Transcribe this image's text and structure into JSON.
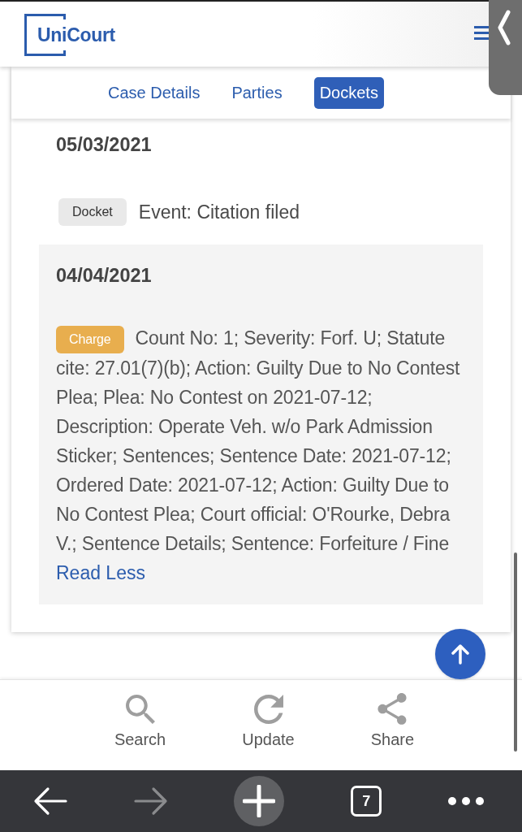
{
  "header": {
    "logo": "UniCourt"
  },
  "tabs": [
    {
      "label": "Case Details",
      "selected": false
    },
    {
      "label": "Parties",
      "selected": false
    },
    {
      "label": "Dockets",
      "selected": true
    }
  ],
  "dockets": [
    {
      "date": "05/03/2021",
      "highlighted": false,
      "entries": [
        {
          "kind": "docket",
          "badge": "Docket",
          "text": "Event: Citation filed"
        }
      ]
    },
    {
      "date": "04/04/2021",
      "highlighted": true,
      "entries": [
        {
          "kind": "charge",
          "badge": "Charge",
          "text": "Count No: 1; Severity: Forf. U; Statute cite: 27.01(7)(b); Action: Guilty Due to No Contest Plea; Plea: No Contest on 2021-07-12; Description: Operate Veh. w/o Park Admission Sticker; Sentences; Sentence Date: 2021-07-12; Ordered Date: 2021-07-12; Action: Guilty Due to No Contest Plea; Court official: O'Rourke, Debra V.; Sentence Details; Sentence: Forfeiture / Fine",
          "link": "Read Less"
        }
      ]
    }
  ],
  "actions": [
    {
      "kind": "search",
      "label": "Search"
    },
    {
      "kind": "update",
      "label": "Update"
    },
    {
      "kind": "share",
      "label": "Share"
    }
  ],
  "browser_bar": {
    "buttons": [
      {
        "kind": "back",
        "disabled": false
      },
      {
        "kind": "forward",
        "disabled": true
      },
      {
        "kind": "new_tab",
        "disabled": false
      },
      {
        "kind": "tabs",
        "label": "7",
        "disabled": false
      },
      {
        "kind": "menu",
        "disabled": false
      }
    ]
  }
}
